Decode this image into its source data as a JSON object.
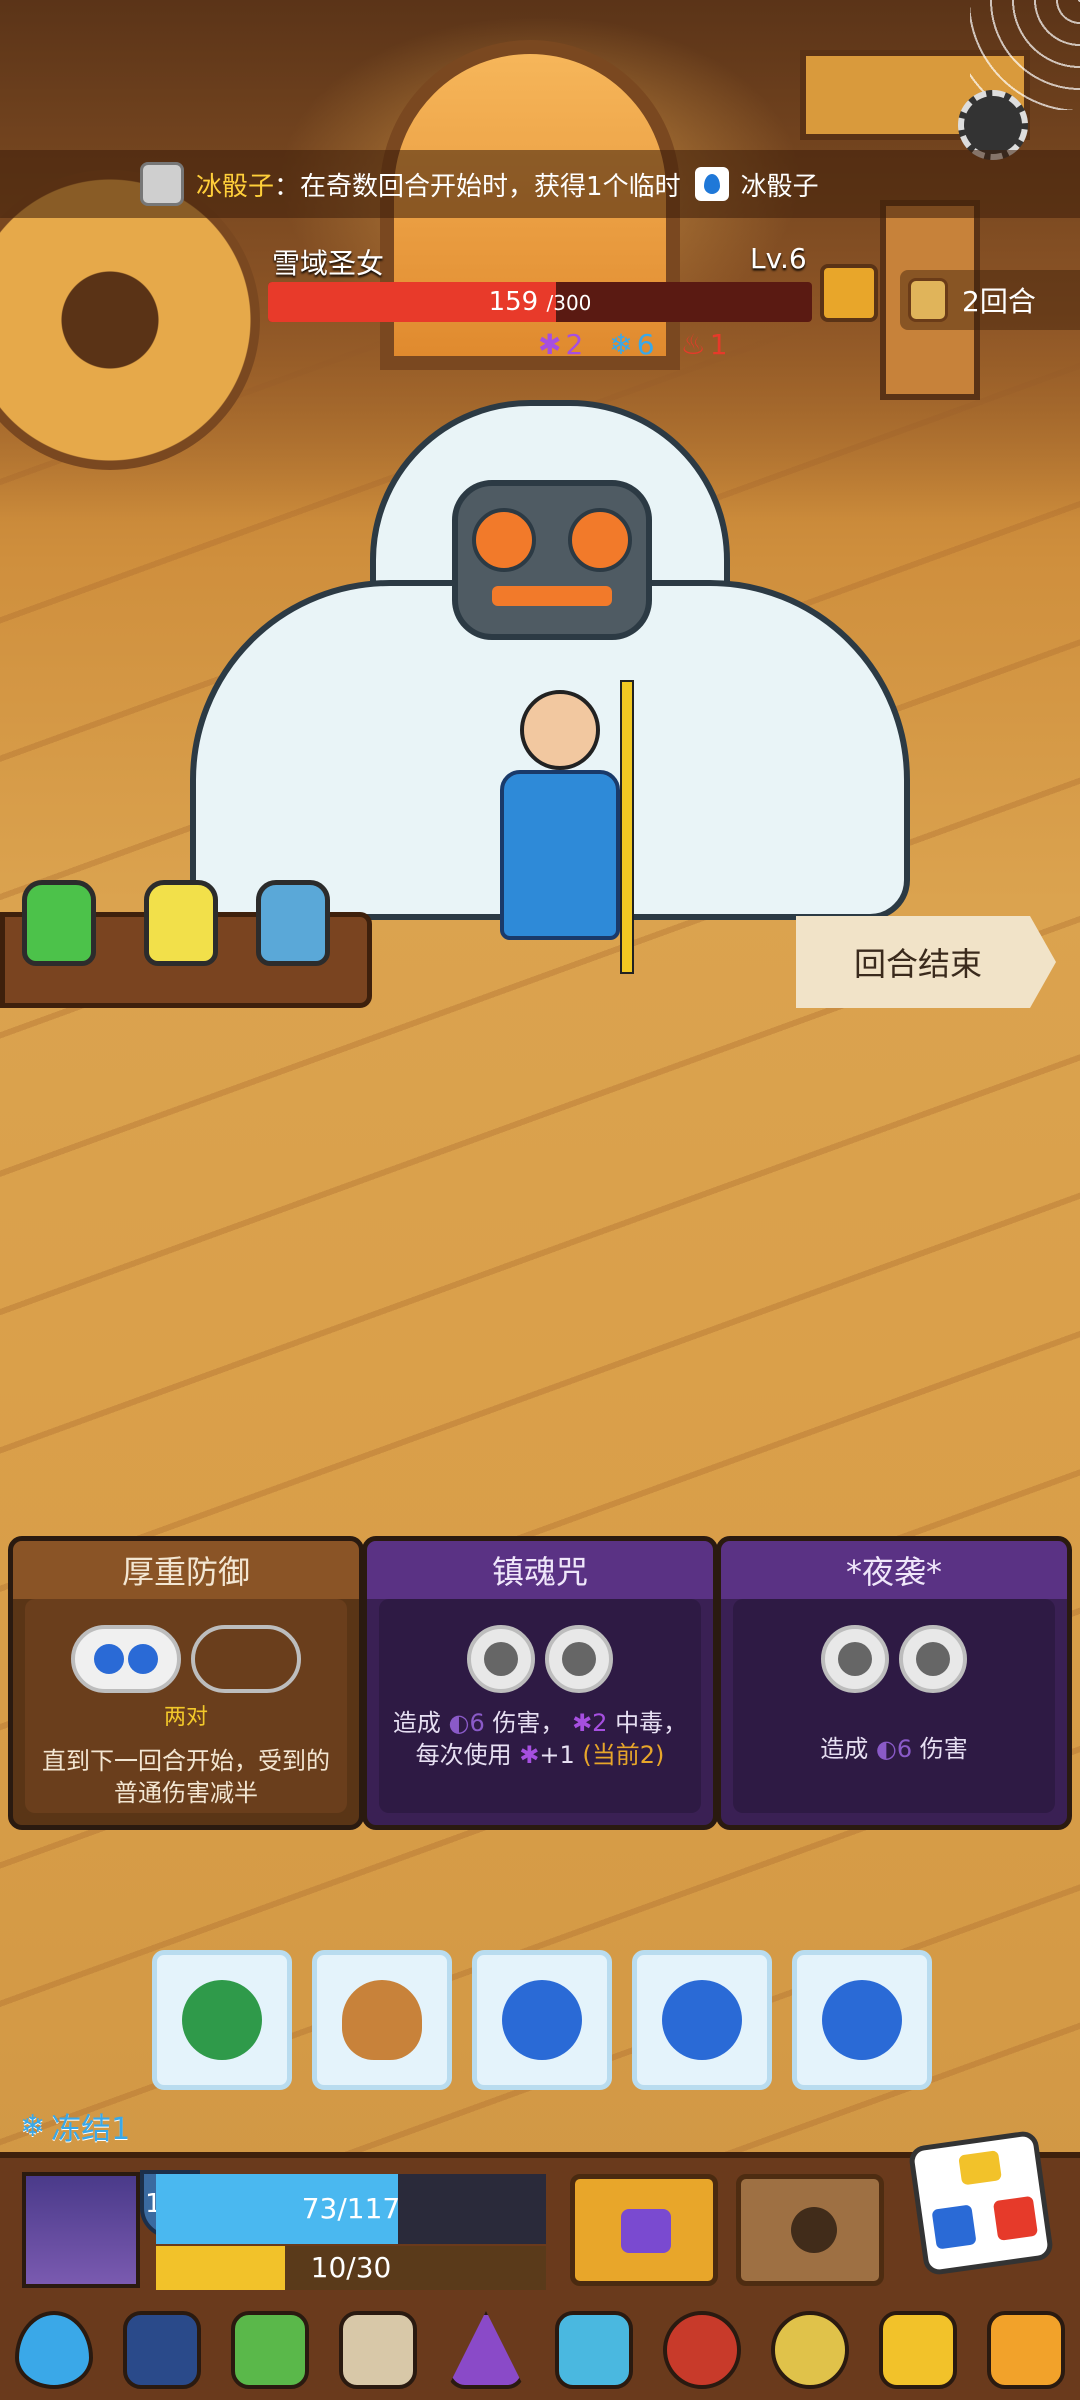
{
  "relic_bar": {
    "relic_name": "冰骰子",
    "relic_desc": "在奇数回合开始时，获得1个临时",
    "reward_name": "冰骰子"
  },
  "enemy": {
    "name": "雪域圣女",
    "level": "Lv.6",
    "hp_current": "159",
    "hp_max": "/300",
    "hp_fraction": 0.53,
    "round": "2回合",
    "statuses": [
      {
        "icon": "poison-icon",
        "value": "2",
        "color": "#a64fe0"
      },
      {
        "icon": "snowflake-icon",
        "value": "6",
        "color": "#3aa8e8"
      },
      {
        "icon": "fire-icon",
        "value": "1",
        "color": "#e63a2a"
      }
    ]
  },
  "end_turn_label": "回合结束",
  "cards": [
    {
      "title": "厚重防御",
      "sub": "两对",
      "desc": "直到下一回合开始，受到的普通伤害减半"
    },
    {
      "title": "镇魂咒",
      "desc_a": "造成",
      "dmg": "6",
      "desc_b": "伤害，",
      "poison": "2",
      "desc_c": "中毒，每次使用",
      "inc": "+1",
      "current": "(当前2)"
    },
    {
      "title": "*夜袭*",
      "desc_a": "造成",
      "dmg": "6",
      "desc_b": "伤害"
    }
  ],
  "dice": [
    {
      "face": "watermelon",
      "color": "#2f9a4a"
    },
    {
      "face": "seed",
      "color": "#c8823a"
    },
    {
      "face": "blueberry",
      "color": "#2a6ad6"
    },
    {
      "face": "blueberry",
      "color": "#2a6ad6"
    },
    {
      "face": "blueberry",
      "color": "#2a6ad6"
    }
  ],
  "freeze_label": "冻结1",
  "player": {
    "shield": "107",
    "hp": "73/117",
    "hp_fraction": 0.62,
    "energy": "10/30",
    "energy_fraction": 0.33
  },
  "relic_icons": [
    "water-drop-icon",
    "cape-icon",
    "grass-icon",
    "hammer-icon",
    "flask-icon",
    "ice-mask-icon",
    "bracelet-icon",
    "compass-icon",
    "crown-icon",
    "glove-icon"
  ]
}
